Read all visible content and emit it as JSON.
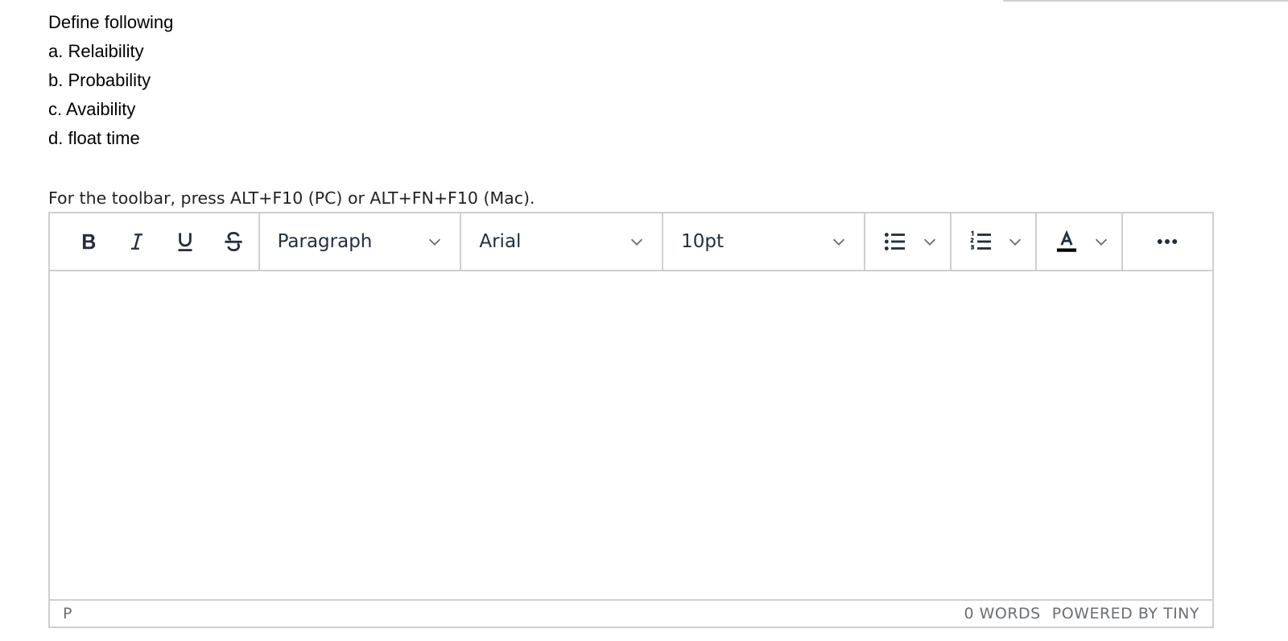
{
  "question": {
    "lines": [
      "Define following",
      "a. Relaibility",
      "b. Probability",
      "c. Avaibility",
      "d. float time"
    ]
  },
  "hint": "For the toolbar, press ALT+F10 (PC) or ALT+FN+F10 (Mac).",
  "toolbar": {
    "block_format": "Paragraph",
    "font_family": "Arial",
    "font_size": "10pt",
    "icons": {
      "bold": "bold-icon",
      "italic": "italic-icon",
      "underline": "underline-icon",
      "strikethrough": "strikethrough-icon",
      "bullet_list": "bullet-list-icon",
      "numbered_list": "numbered-list-icon",
      "text_color": "text-color-icon",
      "more": "more-icon"
    }
  },
  "status": {
    "path": "P",
    "word_count": "0 WORDS",
    "branding": "POWERED BY TINY"
  },
  "colors": {
    "icon": "#222f3e",
    "border": "#cfcfcf",
    "status_text": "#6b6f73",
    "text_color_swatch": "#000000"
  }
}
